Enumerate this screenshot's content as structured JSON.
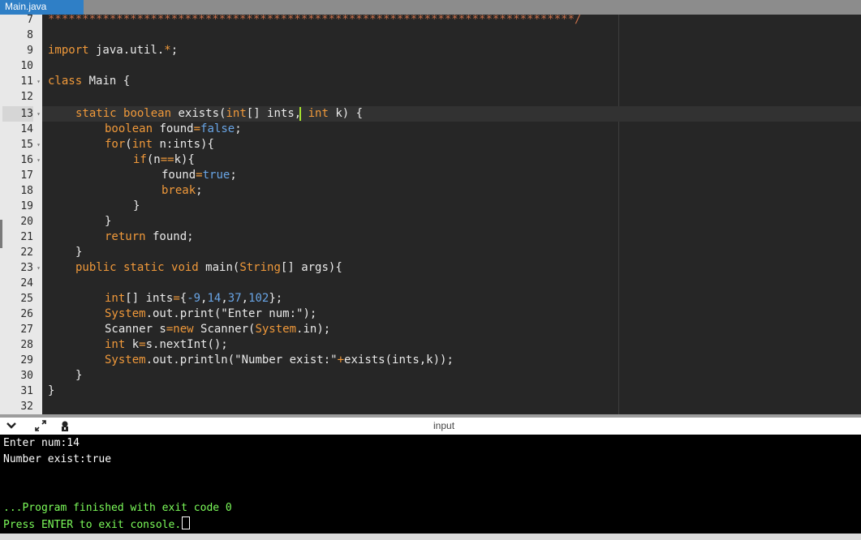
{
  "tab": {
    "title": "Main.java"
  },
  "editor": {
    "line_numbers": [
      "7",
      "8",
      "9",
      "10",
      "11",
      "12",
      "13",
      "14",
      "15",
      "16",
      "17",
      "18",
      "19",
      "20",
      "21",
      "22",
      "23",
      "24",
      "25",
      "26",
      "27",
      "28",
      "29",
      "30",
      "31",
      "32"
    ],
    "code": {
      "l7": "*****************************************************************************/",
      "l9_kw": "import",
      "l9_rest": " java.util.",
      "l9_star": "*",
      "l9_end": ";",
      "l11_kw": "class",
      "l11_rest": " Main {",
      "l13_kw": "static",
      "l13_type": "boolean",
      "l13_name": " exists(",
      "l13_int": "int",
      "l13_arr": "[] ints, ",
      "l13_int2": "int",
      "l13_end": " k) {",
      "l14_type": "boolean",
      "l14_name": " found",
      "l14_eq": "=",
      "l14_val": "false",
      "l14_end": ";",
      "l15_kw": "for",
      "l15_p": "(",
      "l15_int": "int",
      "l15_rest": " n:ints){",
      "l16_kw": "if",
      "l16_p": "(n",
      "l16_op": "==",
      "l16_rest": "k){",
      "l17_name": "found",
      "l17_eq": "=",
      "l17_val": "true",
      "l17_end": ";",
      "l18_kw": "break",
      "l18_end": ";",
      "l19": "}",
      "l20": "}",
      "l21_kw": "return",
      "l21_rest": " found;",
      "l22": "}",
      "l23_kw1": "public",
      "l23_kw2": " static",
      "l23_kw3": " void",
      "l23_name": " main(",
      "l23_type": "String",
      "l23_rest": "[] args){",
      "l25_int": "int",
      "l25_rest": "[] ints",
      "l25_eq": "=",
      "l25_open": "{",
      "l25_n1": "-9",
      "l25_c1": ",",
      "l25_n2": "14",
      "l25_c2": ",",
      "l25_n3": "37",
      "l25_c3": ",",
      "l25_n4": "102",
      "l25_end": "};",
      "l26_sys": "System",
      "l26_rest": ".out.print(",
      "l26_str": "\"Enter num:\"",
      "l26_end": ");",
      "l27_a": "Scanner s",
      "l27_eq": "=",
      "l27_new": "new",
      "l27_b": " Scanner(",
      "l27_sys": "System",
      "l27_end": ".in);",
      "l28_int": "int",
      "l28_a": " k",
      "l28_eq": "=",
      "l28_end": "s.nextInt();",
      "l29_sys": "System",
      "l29_a": ".out.println(",
      "l29_str": "\"Number exist:\"",
      "l29_plus": "+",
      "l29_end": "exists(ints,k));",
      "l30": "}",
      "l31": "}"
    }
  },
  "console": {
    "label": "input",
    "lines": {
      "l1": "Enter num:14",
      "l2": "Number exist:true",
      "l3": "...Program finished with exit code 0",
      "l4": "Press ENTER to exit console."
    },
    "icons": [
      "chevron-down-icon",
      "expand-icon",
      "settings-icon"
    ]
  },
  "colors": {
    "keyword": "#f0993a",
    "literal": "#69a5e6",
    "tab": "#2f7fc6",
    "console_green": "#7cfc5a",
    "editor_bg": "#262626"
  }
}
